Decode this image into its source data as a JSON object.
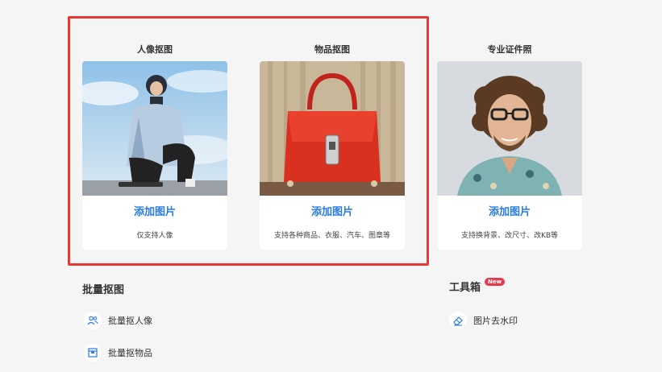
{
  "cards": [
    {
      "title": "人像抠图",
      "action": "添加图片",
      "desc": "仅支持人像"
    },
    {
      "title": "物品抠图",
      "action": "添加图片",
      "desc": "支持各种商品、衣服、汽车、图章等"
    },
    {
      "title": "专业证件照",
      "action": "添加图片",
      "desc": "支持换背景、改尺寸、改KB等"
    }
  ],
  "batch": {
    "title": "批量抠图",
    "items": [
      {
        "label": "批量抠人像",
        "icon": "people-icon"
      },
      {
        "label": "批量抠物品",
        "icon": "box-icon"
      }
    ]
  },
  "toolbox": {
    "title": "工具箱",
    "badge": "New",
    "items": [
      {
        "label": "图片去水印",
        "icon": "eraser-icon"
      }
    ]
  },
  "colors": {
    "accent": "#2a7be4",
    "highlight": "#e53935",
    "badge": "#e53950"
  }
}
